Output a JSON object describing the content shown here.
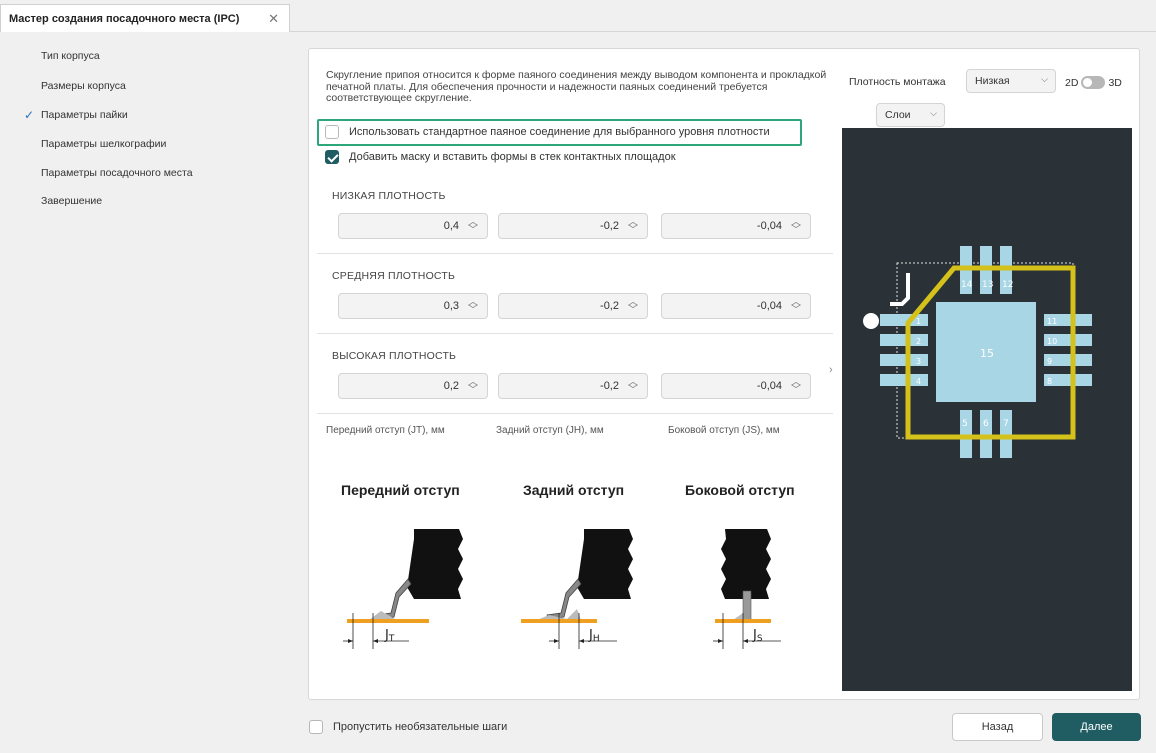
{
  "tab": {
    "title": "Мастер создания посадочного места (IPC)",
    "close": "✕"
  },
  "nav": {
    "items": [
      {
        "label": "Тип корпуса",
        "checked": false
      },
      {
        "label": "Размеры корпуса",
        "checked": false
      },
      {
        "label": "Параметры пайки",
        "checked": true
      },
      {
        "label": "Параметры шелкографии",
        "checked": false
      },
      {
        "label": "Параметры посадочного места",
        "checked": false
      },
      {
        "label": "Завершение",
        "checked": false
      }
    ],
    "check_mark": "✓"
  },
  "description": "Скругление припоя относится к форме паяного соединения между выводом компонента и прокладкой печатной платы. Для обеспечения прочности и надежности паяных соединений требуется соответствующее скругление.",
  "options": {
    "standard_joint": {
      "label": "Использовать стандартное паяное соединение для выбранного уровня плотности",
      "checked": false
    },
    "add_mask": {
      "label": "Добавить маску и вставить формы в стек контактных площадок",
      "checked": true
    }
  },
  "densities": [
    {
      "title": "НИЗКАЯ ПЛОТНОСТЬ",
      "values": [
        "0,4",
        "-0,2",
        "-0,04"
      ]
    },
    {
      "title": "СРЕДНЯЯ ПЛОТНОСТЬ",
      "values": [
        "0,3",
        "-0,2",
        "-0,04"
      ]
    },
    {
      "title": "ВЫСОКАЯ ПЛОТНОСТЬ",
      "values": [
        "0,2",
        "-0,2",
        "-0,04"
      ]
    }
  ],
  "columns": [
    "Передний отступ (JT), мм",
    "Задний отступ (JH), мм",
    "Боковой отступ (JS), мм"
  ],
  "diagrams": {
    "front": {
      "title": "Передний отступ",
      "label": "J",
      "sub": "T"
    },
    "back": {
      "title": "Задний отступ",
      "label": "J",
      "sub": "H"
    },
    "side": {
      "title": "Боковой отступ",
      "label": "J",
      "sub": "S"
    }
  },
  "preview": {
    "density_label": "Плотность монтажа",
    "density_value": "Низкая",
    "mode_2d": "2D",
    "mode_3d": "3D",
    "layers_label": "Слои",
    "collapse": "›",
    "chevron": "⌵",
    "pins": {
      "left": [
        "1",
        "2",
        "3",
        "4"
      ],
      "bottom": [
        "5",
        "6",
        "7"
      ],
      "right": [
        "8",
        "9",
        "10",
        "11"
      ],
      "top": [
        "12",
        "13",
        "14"
      ],
      "center": "15"
    },
    "colors": {
      "board": "#2b3237",
      "pad": "#a9d6e5",
      "outline": "#d4c21a"
    }
  },
  "footer": {
    "skip_label": "Пропустить необязательные шаги",
    "back": "Назад",
    "next": "Далее"
  },
  "colors": {
    "accent": "#1f5d63",
    "highlight": "#2ca77a"
  }
}
